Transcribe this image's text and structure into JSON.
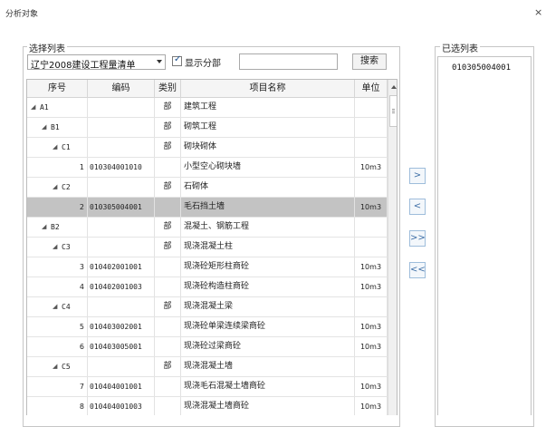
{
  "window": {
    "title": "分析对象",
    "close_symbol": "×"
  },
  "left_panel": {
    "legend": "选择列表",
    "dropdown_value": "辽宁2008建设工程量清单",
    "show_sections_label": "显示分部",
    "show_sections_checked": true,
    "search_value": "",
    "search_button": "搜索"
  },
  "table": {
    "headers": {
      "seq": "序号",
      "code": "编码",
      "category": "类别",
      "name": "项目名称",
      "unit": "单位"
    },
    "rows": [
      {
        "level": 0,
        "node": "A1",
        "seq": "",
        "code": "",
        "category": "部",
        "name": "建筑工程",
        "unit": "",
        "expander": "◢"
      },
      {
        "level": 1,
        "node": "B1",
        "seq": "",
        "code": "",
        "category": "部",
        "name": "砌筑工程",
        "unit": "",
        "expander": "◢"
      },
      {
        "level": 2,
        "node": "C1",
        "seq": "",
        "code": "",
        "category": "部",
        "name": "砌块砌体",
        "unit": "",
        "expander": "◢"
      },
      {
        "level": 3,
        "node": "",
        "seq": "1",
        "code": "010304001010",
        "category": "",
        "name": "小型空心砌块墙",
        "unit": "10m3",
        "expander": ""
      },
      {
        "level": 2,
        "node": "C2",
        "seq": "",
        "code": "",
        "category": "部",
        "name": "石砌体",
        "unit": "",
        "expander": "◢"
      },
      {
        "level": 3,
        "node": "",
        "seq": "2",
        "code": "010305004001",
        "category": "",
        "name": "毛石挡土墙",
        "unit": "10m3",
        "expander": "",
        "selected": true
      },
      {
        "level": 1,
        "node": "B2",
        "seq": "",
        "code": "",
        "category": "部",
        "name": "混凝土、钢筋工程",
        "unit": "",
        "expander": "◢"
      },
      {
        "level": 2,
        "node": "C3",
        "seq": "",
        "code": "",
        "category": "部",
        "name": "现浇混凝土柱",
        "unit": "",
        "expander": "◢"
      },
      {
        "level": 3,
        "node": "",
        "seq": "3",
        "code": "010402001001",
        "category": "",
        "name": "现浇砼矩形柱商砼",
        "unit": "10m3",
        "expander": ""
      },
      {
        "level": 3,
        "node": "",
        "seq": "4",
        "code": "010402001003",
        "category": "",
        "name": "现浇砼构造柱商砼",
        "unit": "10m3",
        "expander": ""
      },
      {
        "level": 2,
        "node": "C4",
        "seq": "",
        "code": "",
        "category": "部",
        "name": "现浇混凝土梁",
        "unit": "",
        "expander": "◢"
      },
      {
        "level": 3,
        "node": "",
        "seq": "5",
        "code": "010403002001",
        "category": "",
        "name": "现浇砼单梁连续梁商砼",
        "unit": "10m3",
        "expander": ""
      },
      {
        "level": 3,
        "node": "",
        "seq": "6",
        "code": "010403005001",
        "category": "",
        "name": "现浇砼过梁商砼",
        "unit": "10m3",
        "expander": ""
      },
      {
        "level": 2,
        "node": "C5",
        "seq": "",
        "code": "",
        "category": "部",
        "name": "现浇混凝土墙",
        "unit": "",
        "expander": "◢"
      },
      {
        "level": 3,
        "node": "",
        "seq": "7",
        "code": "010404001001",
        "category": "",
        "name": "现浇毛石混凝土墙商砼",
        "unit": "10m3",
        "expander": ""
      },
      {
        "level": 3,
        "node": "",
        "seq": "8",
        "code": "010404001003",
        "category": "",
        "name": "现浇混凝土墙商砼",
        "unit": "10m3",
        "expander": ""
      },
      {
        "level": 3,
        "node": "",
        "seq": "",
        "code": "",
        "category": "",
        "name": "",
        "unit": "",
        "expander": ""
      }
    ]
  },
  "transfer_buttons": {
    "add": ">",
    "remove": "<",
    "add_all": ">>",
    "remove_all": "<<"
  },
  "right_panel": {
    "legend": "已选列表",
    "items": [
      "010305004001"
    ]
  }
}
